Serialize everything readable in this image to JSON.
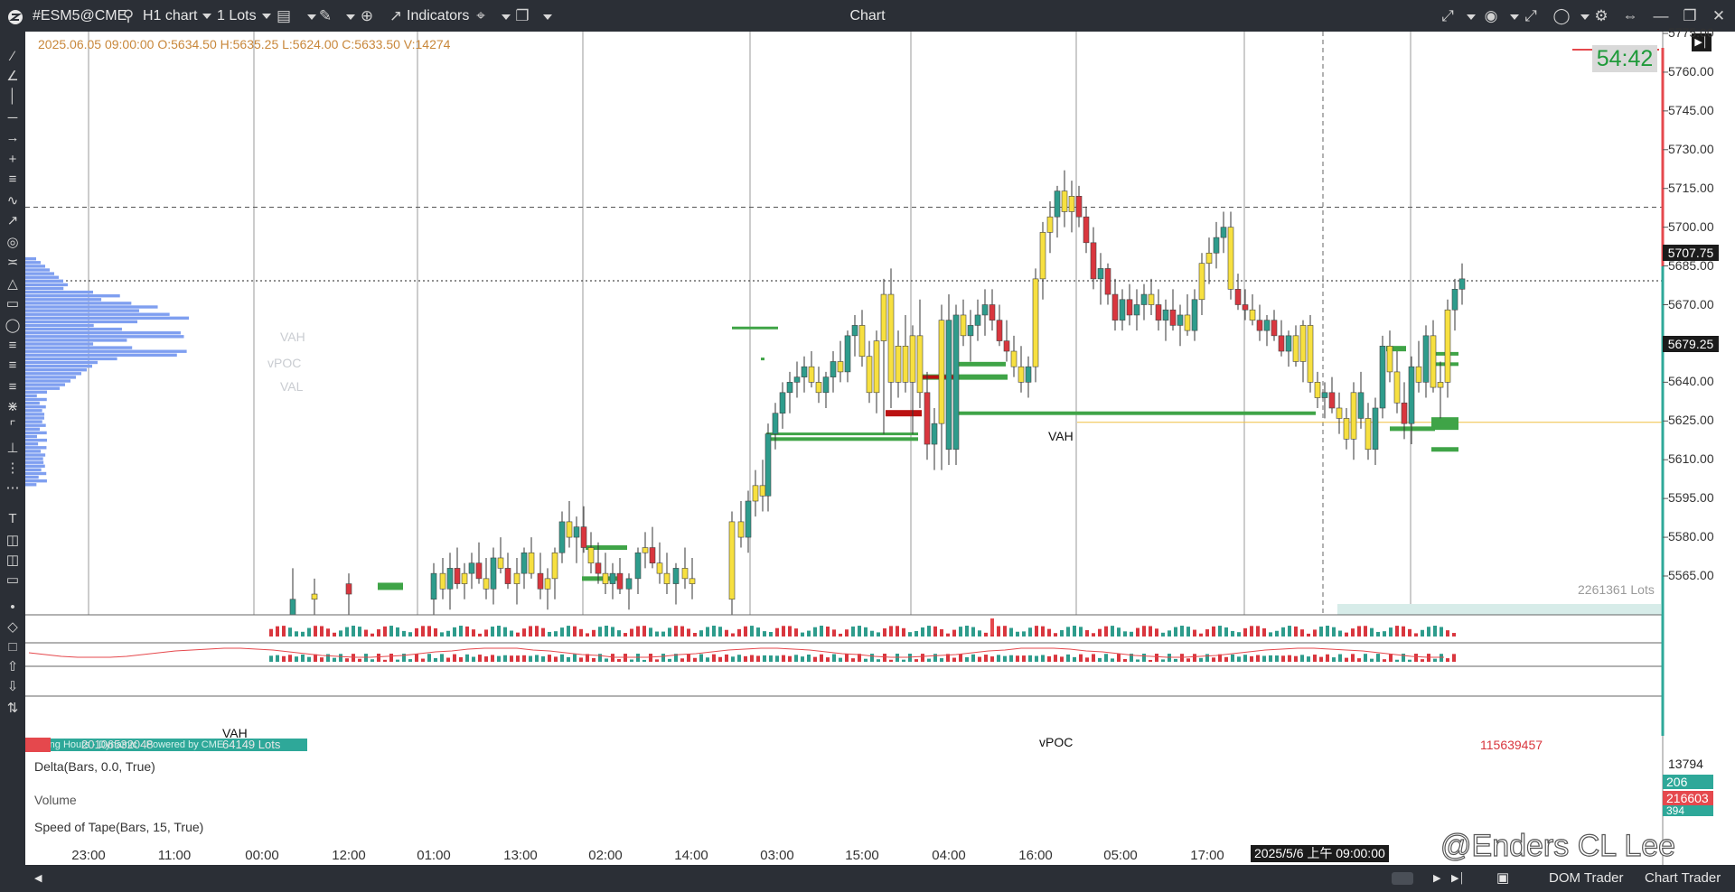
{
  "window": {
    "app_icon": "logo-icon",
    "symbol": "#ESM5@CME",
    "chart_type": "H1 chart",
    "lots": "1 Lots",
    "indicators_label": "Indicators",
    "title": "Chart"
  },
  "ohlc_readout": "2025.06.05 09:00:00 O:5634.50 H:5635.25 L:5624.00 C:5633.50 V:14274",
  "timer": "54:42",
  "price_axis": {
    "ticks": [
      "5775.00",
      "5760.00",
      "5745.00",
      "5730.00",
      "5715.00",
      "5700.00",
      "5685.00",
      "5670.00",
      "5655.00",
      "5640.00",
      "5625.00",
      "5610.00",
      "5595.00",
      "5580.00",
      "5565.00"
    ],
    "current_price": "5679.25",
    "cursor_price": "5707.75"
  },
  "annotations": {
    "vah_session": "VAH",
    "vah_lower": "VAH",
    "vpoc_lower": "vPOC",
    "profile_vah": "VAH",
    "profile_vpoc": "vPOC",
    "profile_val": "VAL",
    "total_lots": "2261361 Lots",
    "profile_lots": "64149 Lots",
    "profile_left_value": "20106532048",
    "volume_total": "115639457",
    "trading_banner": "Trading Hours · Dynamic · Powered by CME"
  },
  "panes": {
    "delta": {
      "label": "Delta(Bars, 0.0, True)",
      "value": "13794",
      "value2": "206"
    },
    "volume": {
      "label": "Volume",
      "value": "216603",
      "value2": "394"
    },
    "speed": {
      "label": "Speed of Tape(Bars, 15, True)"
    }
  },
  "time_axis": {
    "labels": [
      "23:00",
      "11:00",
      "00:00",
      "12:00",
      "01:00",
      "13:00",
      "02:00",
      "14:00",
      "03:00",
      "15:00",
      "04:00",
      "16:00",
      "05:00",
      "17:00"
    ],
    "cursor_label": "2025/5/6 上午 09:00:00"
  },
  "bottom_bar": {
    "dom_trader": "DOM Trader",
    "chart_trader": "Chart Trader"
  },
  "watermark": "@Enders CL Lee",
  "colors": {
    "bull_candle": "#2e9c8c",
    "bear_candle": "#d9363e",
    "yellow_candle": "#f7e040",
    "volume_profile": "#7f9ff0",
    "level_green": "#3fa447",
    "level_red": "#bb1111",
    "chrome": "#2b2f36",
    "ohlc_text": "#c8873a",
    "timer_text": "#1f9a3a"
  }
}
